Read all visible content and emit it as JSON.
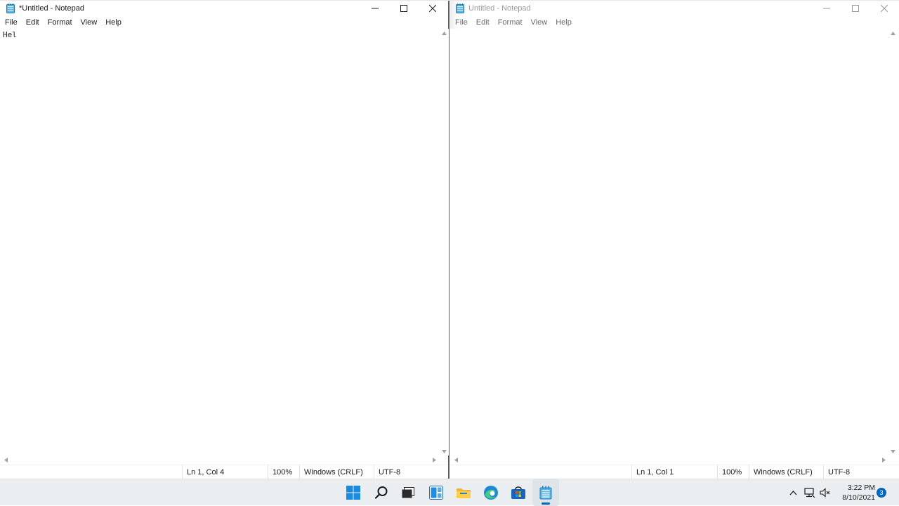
{
  "left_window": {
    "title": "*Untitled - Notepad",
    "menu": [
      "File",
      "Edit",
      "Format",
      "View",
      "Help"
    ],
    "content": "Hel",
    "status": {
      "position": "Ln 1, Col 4",
      "zoom": "100%",
      "line_ending": "Windows (CRLF)",
      "encoding": "UTF-8"
    },
    "focused": true
  },
  "right_window": {
    "title": "Untitled - Notepad",
    "menu": [
      "File",
      "Edit",
      "Format",
      "View",
      "Help"
    ],
    "content": "",
    "status": {
      "position": "Ln 1, Col 1",
      "zoom": "100%",
      "line_ending": "Windows (CRLF)",
      "encoding": "UTF-8"
    },
    "focused": false
  },
  "taskbar": {
    "icons": [
      "start-icon",
      "search-icon",
      "task-view-icon",
      "widgets-icon",
      "file-explorer-icon",
      "edge-icon",
      "store-icon",
      "notepad-icon"
    ],
    "active_app": "notepad-icon",
    "clock": {
      "time": "3:22 PM",
      "date": "8/10/2021"
    },
    "notification_count": "3"
  },
  "colors": {
    "accent": "#0067c0",
    "taskbar_bg": "#eaeef1",
    "notepad_icon": "#2f9fd8"
  }
}
